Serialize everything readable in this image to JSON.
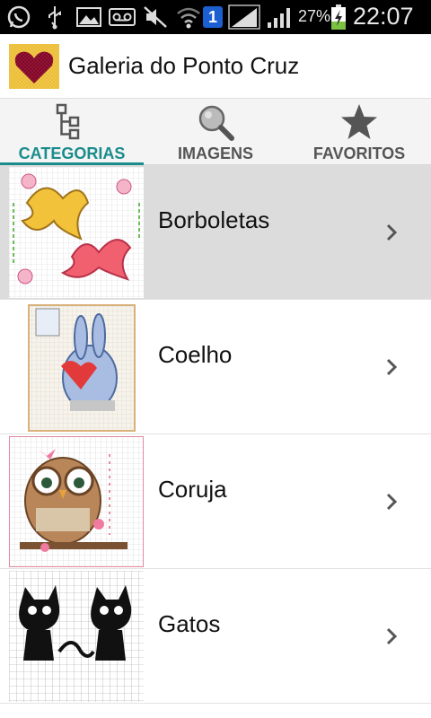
{
  "status_bar": {
    "battery_percent": "27%",
    "clock": "22:07",
    "notification_badge": "1",
    "icons": [
      "whatsapp-icon",
      "usb-icon",
      "image-icon",
      "voicemail-icon",
      "mute-icon",
      "wifi-icon",
      "notification-badge",
      "signal-icon",
      "signal-icon",
      "battery-icon"
    ]
  },
  "action_bar": {
    "title": "Galeria do Ponto Cruz",
    "logo_icon": "heart-cross-stitch-icon"
  },
  "tabs": [
    {
      "label": "CATEGORIAS",
      "icon": "category-tree-icon",
      "active": true
    },
    {
      "label": "IMAGENS",
      "icon": "magnifier-icon",
      "active": false
    },
    {
      "label": "FAVORITOS",
      "icon": "star-icon",
      "active": false
    }
  ],
  "categories": [
    {
      "label": "Borboletas",
      "thumb_icon": "butterfly-pattern-thumbnail",
      "selected": true
    },
    {
      "label": "Coelho",
      "thumb_icon": "rabbit-pattern-thumbnail",
      "selected": false
    },
    {
      "label": "Coruja",
      "thumb_icon": "owl-pattern-thumbnail",
      "selected": false
    },
    {
      "label": "Gatos",
      "thumb_icon": "cats-pattern-thumbnail",
      "selected": false
    }
  ],
  "colors": {
    "accent": "#1a8c8c",
    "selected_row": "#dcdcdc",
    "status_bar": "#000000",
    "battery_charging": "#7cc242",
    "badge": "#1c5fd1"
  }
}
